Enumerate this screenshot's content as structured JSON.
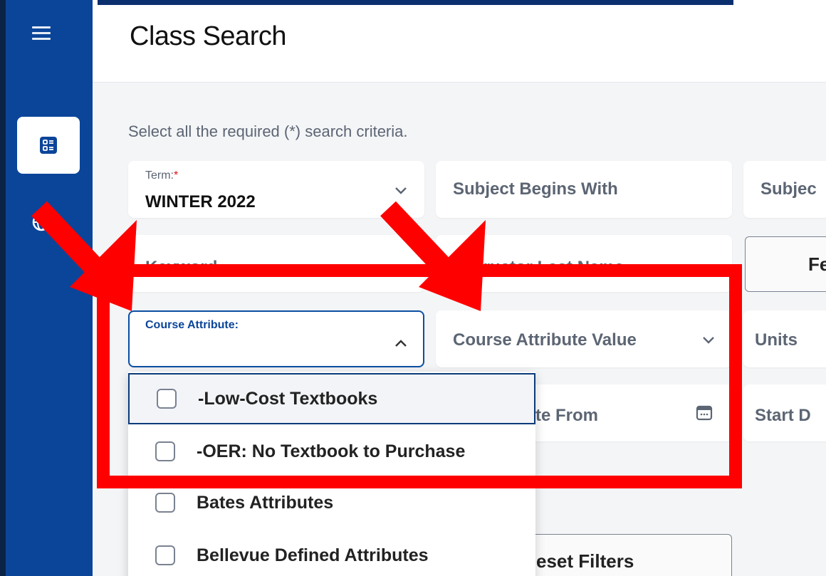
{
  "header": {
    "title": "Class Search"
  },
  "instructions": "Select all the required (*) search criteria.",
  "term": {
    "label": "Term:",
    "required_mark": "*",
    "value": "WINTER 2022"
  },
  "subject_begins": {
    "placeholder": "Subject Begins With"
  },
  "subject_partial": {
    "placeholder": "Subjec"
  },
  "keyword": {
    "placeholder": "Keyword"
  },
  "instructor": {
    "placeholder": "Instructor Last Name"
  },
  "fees_button": {
    "label": "Fe"
  },
  "course_attribute": {
    "label": "Course Attribute:"
  },
  "course_attribute_value": {
    "placeholder": "Course Attribute Value"
  },
  "units": {
    "placeholder": "Units"
  },
  "start_date_from": {
    "placeholder": "te From"
  },
  "start_date_partial": {
    "placeholder": "Start D"
  },
  "reset_button": {
    "label": "eset Filters"
  },
  "dropdown": {
    "options": [
      {
        "label": "-Low-Cost Textbooks"
      },
      {
        "label": "-OER: No Textbook to Purchase"
      },
      {
        "label": "Bates Attributes"
      },
      {
        "label": "Bellevue Defined Attributes"
      }
    ]
  },
  "colors": {
    "sidebar": "#0b4599",
    "accent": "#0b2f6e",
    "annotation": "#ff0000",
    "active_border": "#0b3b7a"
  },
  "icons": [
    "menu-icon",
    "class-search-icon",
    "globe-icon",
    "chevron-down-icon",
    "chevron-up-icon",
    "calendar-icon",
    "checkbox-icon"
  ]
}
